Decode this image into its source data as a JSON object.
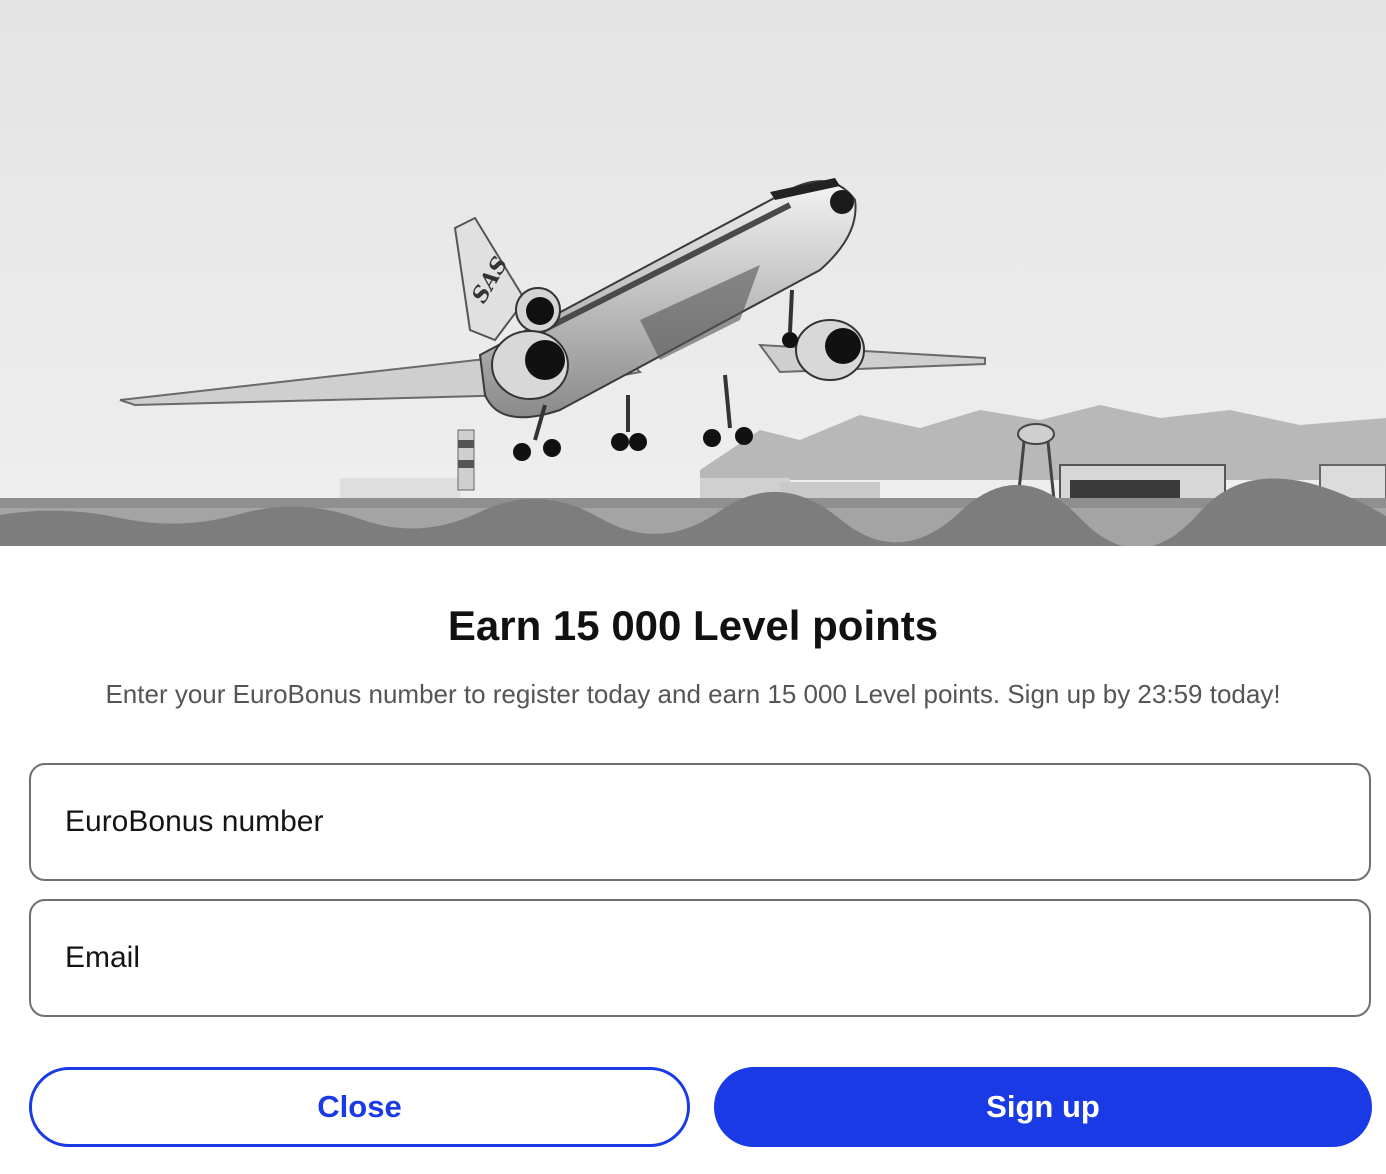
{
  "hero": {
    "image_alt": "Black and white photo of an SAS airliner taking off",
    "tail_logo_text": "SAS"
  },
  "promo": {
    "title": "Earn 15 000 Level points",
    "description": "Enter your EuroBonus number to register today and earn 15 000 Level points. Sign up by 23:59 today!"
  },
  "form": {
    "eurobonus_placeholder": "EuroBonus number",
    "eurobonus_value": "",
    "email_placeholder": "Email",
    "email_value": ""
  },
  "actions": {
    "close_label": "Close",
    "signup_label": "Sign up"
  },
  "colors": {
    "accent": "#1a3ae6",
    "title_text": "#111111",
    "body_text": "#555555",
    "field_border": "#6f6f6f"
  }
}
